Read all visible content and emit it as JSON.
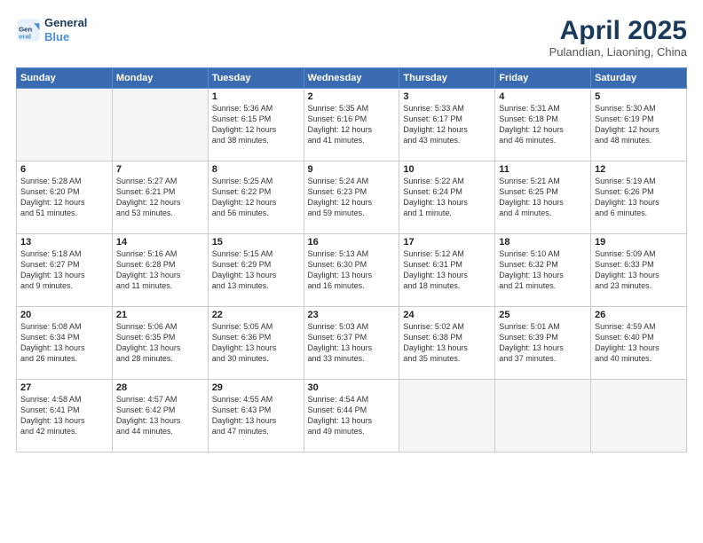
{
  "header": {
    "logo_line1": "General",
    "logo_line2": "Blue",
    "month": "April 2025",
    "location": "Pulandian, Liaoning, China"
  },
  "weekdays": [
    "Sunday",
    "Monday",
    "Tuesday",
    "Wednesday",
    "Thursday",
    "Friday",
    "Saturday"
  ],
  "weeks": [
    [
      {
        "day": "",
        "info": ""
      },
      {
        "day": "",
        "info": ""
      },
      {
        "day": "1",
        "info": "Sunrise: 5:36 AM\nSunset: 6:15 PM\nDaylight: 12 hours\nand 38 minutes."
      },
      {
        "day": "2",
        "info": "Sunrise: 5:35 AM\nSunset: 6:16 PM\nDaylight: 12 hours\nand 41 minutes."
      },
      {
        "day": "3",
        "info": "Sunrise: 5:33 AM\nSunset: 6:17 PM\nDaylight: 12 hours\nand 43 minutes."
      },
      {
        "day": "4",
        "info": "Sunrise: 5:31 AM\nSunset: 6:18 PM\nDaylight: 12 hours\nand 46 minutes."
      },
      {
        "day": "5",
        "info": "Sunrise: 5:30 AM\nSunset: 6:19 PM\nDaylight: 12 hours\nand 48 minutes."
      }
    ],
    [
      {
        "day": "6",
        "info": "Sunrise: 5:28 AM\nSunset: 6:20 PM\nDaylight: 12 hours\nand 51 minutes."
      },
      {
        "day": "7",
        "info": "Sunrise: 5:27 AM\nSunset: 6:21 PM\nDaylight: 12 hours\nand 53 minutes."
      },
      {
        "day": "8",
        "info": "Sunrise: 5:25 AM\nSunset: 6:22 PM\nDaylight: 12 hours\nand 56 minutes."
      },
      {
        "day": "9",
        "info": "Sunrise: 5:24 AM\nSunset: 6:23 PM\nDaylight: 12 hours\nand 59 minutes."
      },
      {
        "day": "10",
        "info": "Sunrise: 5:22 AM\nSunset: 6:24 PM\nDaylight: 13 hours\nand 1 minute."
      },
      {
        "day": "11",
        "info": "Sunrise: 5:21 AM\nSunset: 6:25 PM\nDaylight: 13 hours\nand 4 minutes."
      },
      {
        "day": "12",
        "info": "Sunrise: 5:19 AM\nSunset: 6:26 PM\nDaylight: 13 hours\nand 6 minutes."
      }
    ],
    [
      {
        "day": "13",
        "info": "Sunrise: 5:18 AM\nSunset: 6:27 PM\nDaylight: 13 hours\nand 9 minutes."
      },
      {
        "day": "14",
        "info": "Sunrise: 5:16 AM\nSunset: 6:28 PM\nDaylight: 13 hours\nand 11 minutes."
      },
      {
        "day": "15",
        "info": "Sunrise: 5:15 AM\nSunset: 6:29 PM\nDaylight: 13 hours\nand 13 minutes."
      },
      {
        "day": "16",
        "info": "Sunrise: 5:13 AM\nSunset: 6:30 PM\nDaylight: 13 hours\nand 16 minutes."
      },
      {
        "day": "17",
        "info": "Sunrise: 5:12 AM\nSunset: 6:31 PM\nDaylight: 13 hours\nand 18 minutes."
      },
      {
        "day": "18",
        "info": "Sunrise: 5:10 AM\nSunset: 6:32 PM\nDaylight: 13 hours\nand 21 minutes."
      },
      {
        "day": "19",
        "info": "Sunrise: 5:09 AM\nSunset: 6:33 PM\nDaylight: 13 hours\nand 23 minutes."
      }
    ],
    [
      {
        "day": "20",
        "info": "Sunrise: 5:08 AM\nSunset: 6:34 PM\nDaylight: 13 hours\nand 26 minutes."
      },
      {
        "day": "21",
        "info": "Sunrise: 5:06 AM\nSunset: 6:35 PM\nDaylight: 13 hours\nand 28 minutes."
      },
      {
        "day": "22",
        "info": "Sunrise: 5:05 AM\nSunset: 6:36 PM\nDaylight: 13 hours\nand 30 minutes."
      },
      {
        "day": "23",
        "info": "Sunrise: 5:03 AM\nSunset: 6:37 PM\nDaylight: 13 hours\nand 33 minutes."
      },
      {
        "day": "24",
        "info": "Sunrise: 5:02 AM\nSunset: 6:38 PM\nDaylight: 13 hours\nand 35 minutes."
      },
      {
        "day": "25",
        "info": "Sunrise: 5:01 AM\nSunset: 6:39 PM\nDaylight: 13 hours\nand 37 minutes."
      },
      {
        "day": "26",
        "info": "Sunrise: 4:59 AM\nSunset: 6:40 PM\nDaylight: 13 hours\nand 40 minutes."
      }
    ],
    [
      {
        "day": "27",
        "info": "Sunrise: 4:58 AM\nSunset: 6:41 PM\nDaylight: 13 hours\nand 42 minutes."
      },
      {
        "day": "28",
        "info": "Sunrise: 4:57 AM\nSunset: 6:42 PM\nDaylight: 13 hours\nand 44 minutes."
      },
      {
        "day": "29",
        "info": "Sunrise: 4:55 AM\nSunset: 6:43 PM\nDaylight: 13 hours\nand 47 minutes."
      },
      {
        "day": "30",
        "info": "Sunrise: 4:54 AM\nSunset: 6:44 PM\nDaylight: 13 hours\nand 49 minutes."
      },
      {
        "day": "",
        "info": ""
      },
      {
        "day": "",
        "info": ""
      },
      {
        "day": "",
        "info": ""
      }
    ]
  ]
}
